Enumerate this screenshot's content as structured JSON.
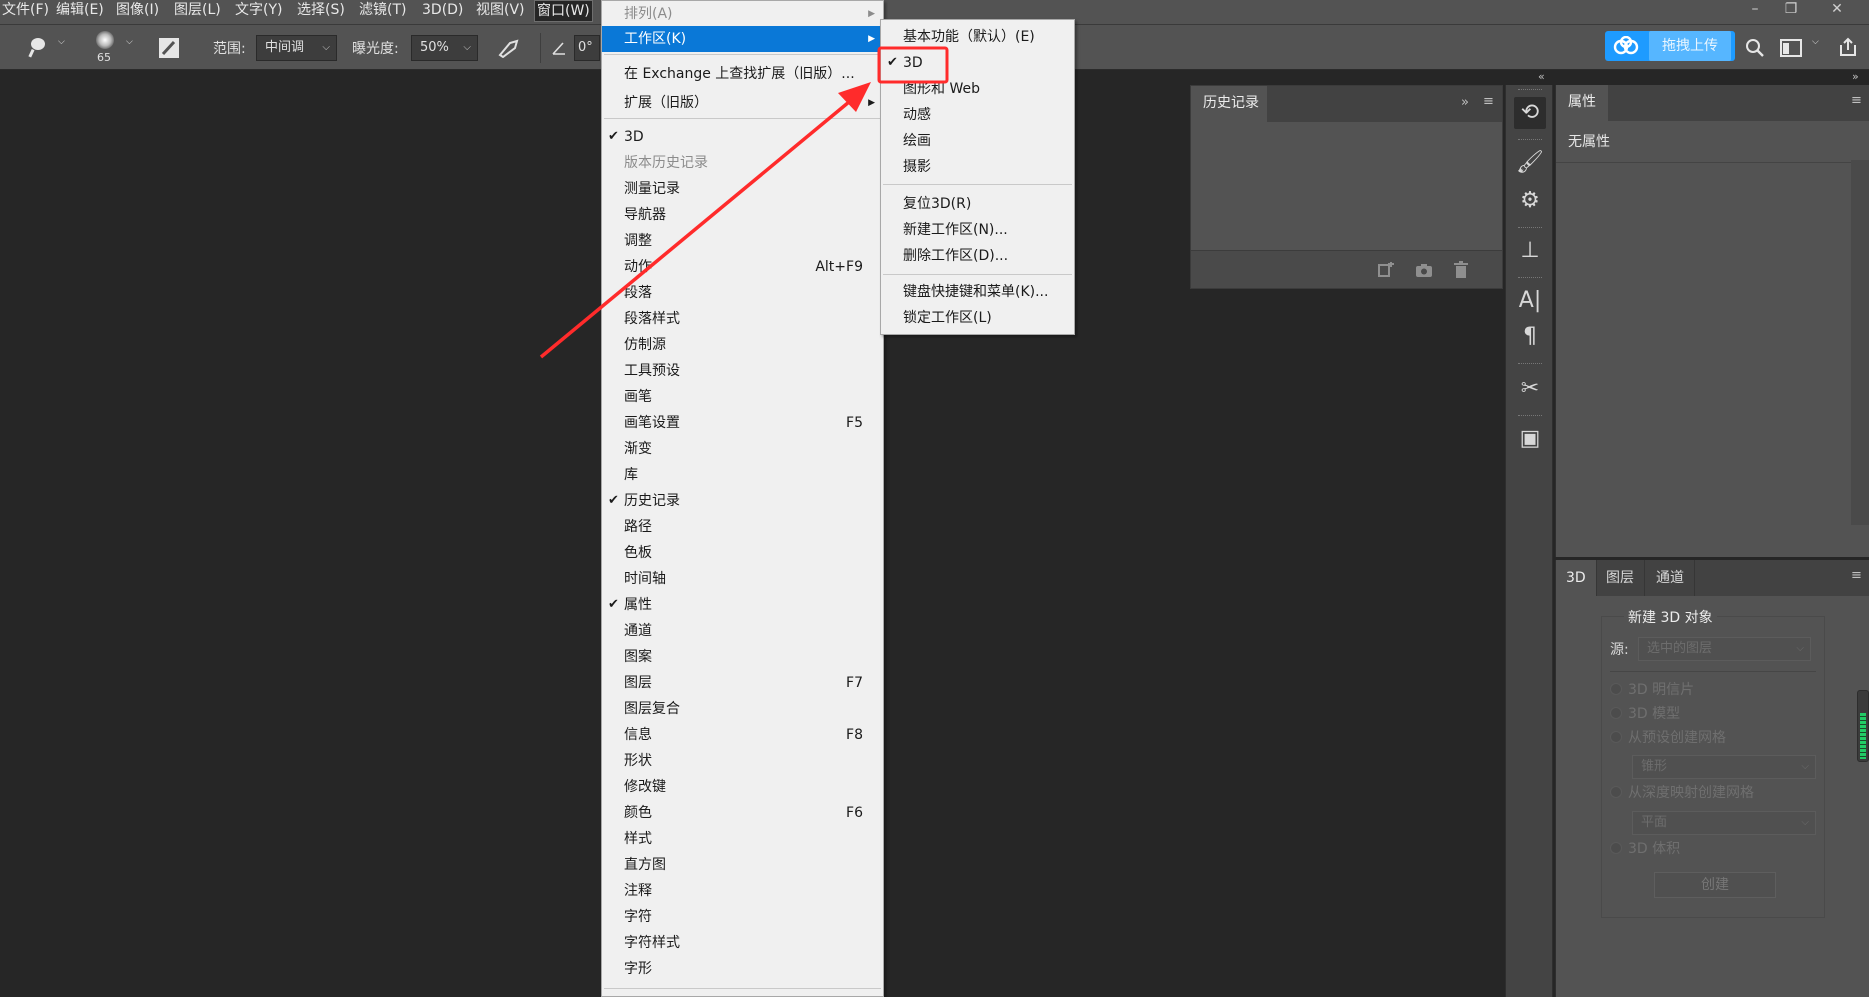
{
  "menubar": {
    "items": [
      {
        "label": "文件(F)"
      },
      {
        "label": "编辑(E)"
      },
      {
        "label": "图像(I)"
      },
      {
        "label": "图层(L)"
      },
      {
        "label": "文字(Y)"
      },
      {
        "label": "选择(S)"
      },
      {
        "label": "滤镜(T)"
      },
      {
        "label": "3D(D)"
      },
      {
        "label": "视图(V)"
      },
      {
        "label": "窗口(W)"
      }
    ],
    "window_buttons": {
      "minimize": "–",
      "restore": "❐",
      "close": "✕"
    }
  },
  "optionsbar": {
    "brush_size": "65",
    "range_label": "范围:",
    "range_value": "中间调",
    "exposure_label": "曝光度:",
    "exposure_value": "50%",
    "angle_value": "0°",
    "upload_button": "拖拽上传"
  },
  "history_panel": {
    "tab": "历史记录",
    "collapse_icon": "»",
    "menu_icon": "≡"
  },
  "properties_panel": {
    "tab": "属性",
    "message": "无属性",
    "menu_icon": "≡"
  },
  "panel_3d": {
    "tabs": [
      "3D",
      "图层",
      "通道"
    ],
    "group_title": "新建 3D 对象",
    "source_label": "源:",
    "source_value": "选中的图层",
    "options": [
      "3D 明信片",
      "3D 模型",
      "从预设创建网格"
    ],
    "preset_value": "锥形",
    "depth_option": "从深度映射创建网格",
    "depth_value": "平面",
    "volume_option": "3D 体积",
    "create_button": "创建"
  },
  "window_menu": {
    "top_items": [
      {
        "label": "排列(A)",
        "disabled": true
      },
      {
        "label": "工作区(K)",
        "highlighted": true
      }
    ],
    "exchange_items": [
      {
        "label": "在 Exchange 上查找扩展（旧版）...",
        "disabled": false
      },
      {
        "label": "扩展（旧版）",
        "disabled": false
      }
    ],
    "panel_items": [
      {
        "label": "3D",
        "checked": true,
        "shortcut": ""
      },
      {
        "label": "版本历史记录",
        "checked": false,
        "shortcut": "",
        "disabled": true
      },
      {
        "label": "测量记录",
        "checked": false,
        "shortcut": ""
      },
      {
        "label": "导航器",
        "checked": false,
        "shortcut": ""
      },
      {
        "label": "调整",
        "checked": false,
        "shortcut": ""
      },
      {
        "label": "动作",
        "checked": false,
        "shortcut": "Alt+F9"
      },
      {
        "label": "段落",
        "checked": false,
        "shortcut": ""
      },
      {
        "label": "段落样式",
        "checked": false,
        "shortcut": ""
      },
      {
        "label": "仿制源",
        "checked": false,
        "shortcut": ""
      },
      {
        "label": "工具预设",
        "checked": false,
        "shortcut": ""
      },
      {
        "label": "画笔",
        "checked": false,
        "shortcut": ""
      },
      {
        "label": "画笔设置",
        "checked": false,
        "shortcut": "F5"
      },
      {
        "label": "渐变",
        "checked": false,
        "shortcut": ""
      },
      {
        "label": "库",
        "checked": false,
        "shortcut": ""
      },
      {
        "label": "历史记录",
        "checked": true,
        "shortcut": ""
      },
      {
        "label": "路径",
        "checked": false,
        "shortcut": ""
      },
      {
        "label": "色板",
        "checked": false,
        "shortcut": ""
      },
      {
        "label": "时间轴",
        "checked": false,
        "shortcut": ""
      },
      {
        "label": "属性",
        "checked": true,
        "shortcut": ""
      },
      {
        "label": "通道",
        "checked": false,
        "shortcut": ""
      },
      {
        "label": "图案",
        "checked": false,
        "shortcut": ""
      },
      {
        "label": "图层",
        "checked": false,
        "shortcut": "F7"
      },
      {
        "label": "图层复合",
        "checked": false,
        "shortcut": ""
      },
      {
        "label": "信息",
        "checked": false,
        "shortcut": "F8"
      },
      {
        "label": "形状",
        "checked": false,
        "shortcut": ""
      },
      {
        "label": "修改键",
        "checked": false,
        "shortcut": ""
      },
      {
        "label": "颜色",
        "checked": false,
        "shortcut": "F6"
      },
      {
        "label": "样式",
        "checked": false,
        "shortcut": ""
      },
      {
        "label": "直方图",
        "checked": false,
        "shortcut": ""
      },
      {
        "label": "注释",
        "checked": false,
        "shortcut": ""
      },
      {
        "label": "字符",
        "checked": false,
        "shortcut": ""
      },
      {
        "label": "字符样式",
        "checked": false,
        "shortcut": ""
      },
      {
        "label": "字形",
        "checked": false,
        "shortcut": ""
      }
    ]
  },
  "workspace_submenu": {
    "group1": [
      {
        "label": "基本功能（默认）(E)",
        "checked": false
      },
      {
        "label": "3D",
        "checked": true
      },
      {
        "label": "图形和 Web",
        "checked": false
      },
      {
        "label": "动感",
        "checked": false
      },
      {
        "label": "绘画",
        "checked": false
      },
      {
        "label": "摄影",
        "checked": false
      }
    ],
    "group2": [
      {
        "label": "复位3D(R)"
      },
      {
        "label": "新建工作区(N)..."
      },
      {
        "label": "删除工作区(D)..."
      }
    ],
    "group3": [
      {
        "label": "键盘快捷键和菜单(K)..."
      },
      {
        "label": "锁定工作区(L)"
      }
    ]
  },
  "annotation": {
    "arrow_color": "#ff2b2b",
    "box_color": "#ff2b2b"
  }
}
